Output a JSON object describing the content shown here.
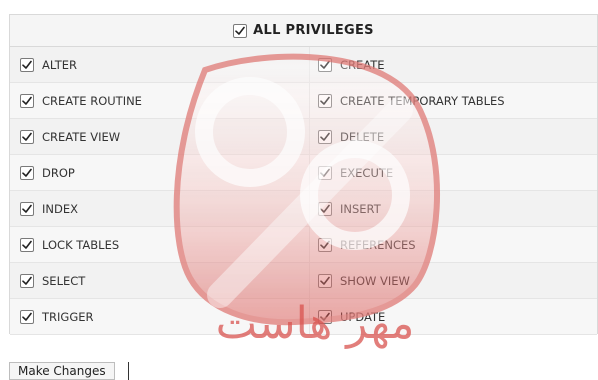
{
  "header": {
    "label": "ALL PRIVILEGES"
  },
  "rows": [
    {
      "left": "ALTER",
      "right": "CREATE"
    },
    {
      "left": "CREATE ROUTINE",
      "right": "CREATE TEMPORARY TABLES"
    },
    {
      "left": "CREATE VIEW",
      "right": "DELETE"
    },
    {
      "left": "DROP",
      "right": "EXECUTE"
    },
    {
      "left": "INDEX",
      "right": "INSERT"
    },
    {
      "left": "LOCK TABLES",
      "right": "REFERENCES"
    },
    {
      "left": "SELECT",
      "right": "SHOW VIEW"
    },
    {
      "left": "TRIGGER",
      "right": "UPDATE"
    }
  ],
  "footer": {
    "button": "Make Changes"
  },
  "watermark": {
    "text": "مهر هاست"
  },
  "colors": {
    "accent": "#d9534f",
    "border": "#d9d9d9"
  }
}
